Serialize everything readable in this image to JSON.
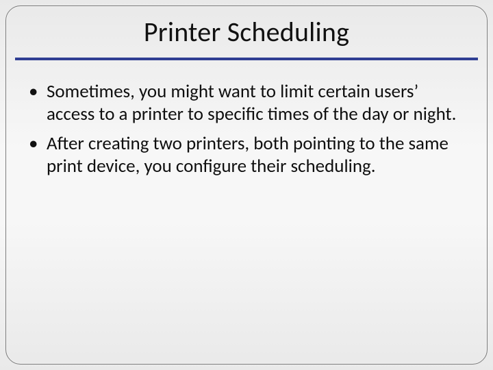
{
  "slide": {
    "title": "Printer Scheduling",
    "bullets": [
      "Sometimes, you might want to limit certain users’ access to a printer to specific times of the day or night.",
      "After creating two printers, both pointing to the same print device, you configure their scheduling."
    ]
  }
}
